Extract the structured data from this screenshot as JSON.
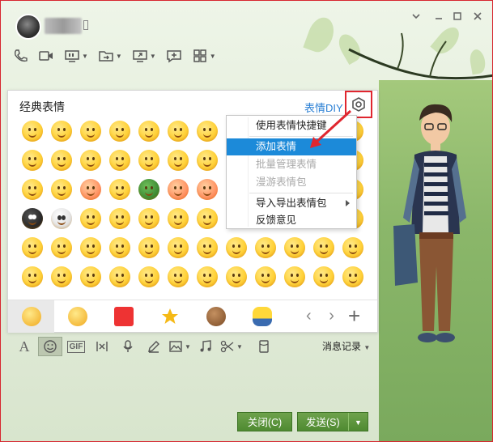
{
  "window": {
    "controls": [
      "chevron-down-icon",
      "minimize-icon",
      "maximize-icon",
      "close-icon"
    ]
  },
  "toolbar": {
    "icons": [
      "phone-icon",
      "video-camera-icon",
      "screen-share-icon",
      "file-transfer-icon",
      "remote-desktop-icon",
      "chat-bubble-icon",
      "apps-grid-icon"
    ]
  },
  "emoji_panel": {
    "title": "经典表情",
    "diy_link": "表情DIY",
    "settings_icon": "settings-icon",
    "tabs": [
      "classic-emoji-tab",
      "emoji-tab",
      "custom-emoji-tab",
      "favorites-tab",
      "bear-tab",
      "minion-tab"
    ],
    "nav_arrows": "‹ ›",
    "add_label": "+"
  },
  "context_menu": {
    "items": [
      {
        "label": "使用表情快捷键",
        "state": "normal"
      },
      {
        "label": "添加表情",
        "state": "highlighted"
      },
      {
        "label": "批量管理表情",
        "state": "disabled"
      },
      {
        "label": "漫游表情包",
        "state": "disabled"
      },
      {
        "label": "导入导出表情包",
        "state": "submenu"
      },
      {
        "label": "反馈意见",
        "state": "normal"
      }
    ]
  },
  "input_toolbar": {
    "font_label": "A",
    "gif_label": "GIF",
    "history_label": "消息记录"
  },
  "buttons": {
    "close": "关闭(C)",
    "send": "发送(S)"
  },
  "colors": {
    "accent_red": "#e0262f",
    "highlight_blue": "#1c8ad9",
    "button_green": "#5a9438",
    "link_blue": "#2a7fd4"
  }
}
